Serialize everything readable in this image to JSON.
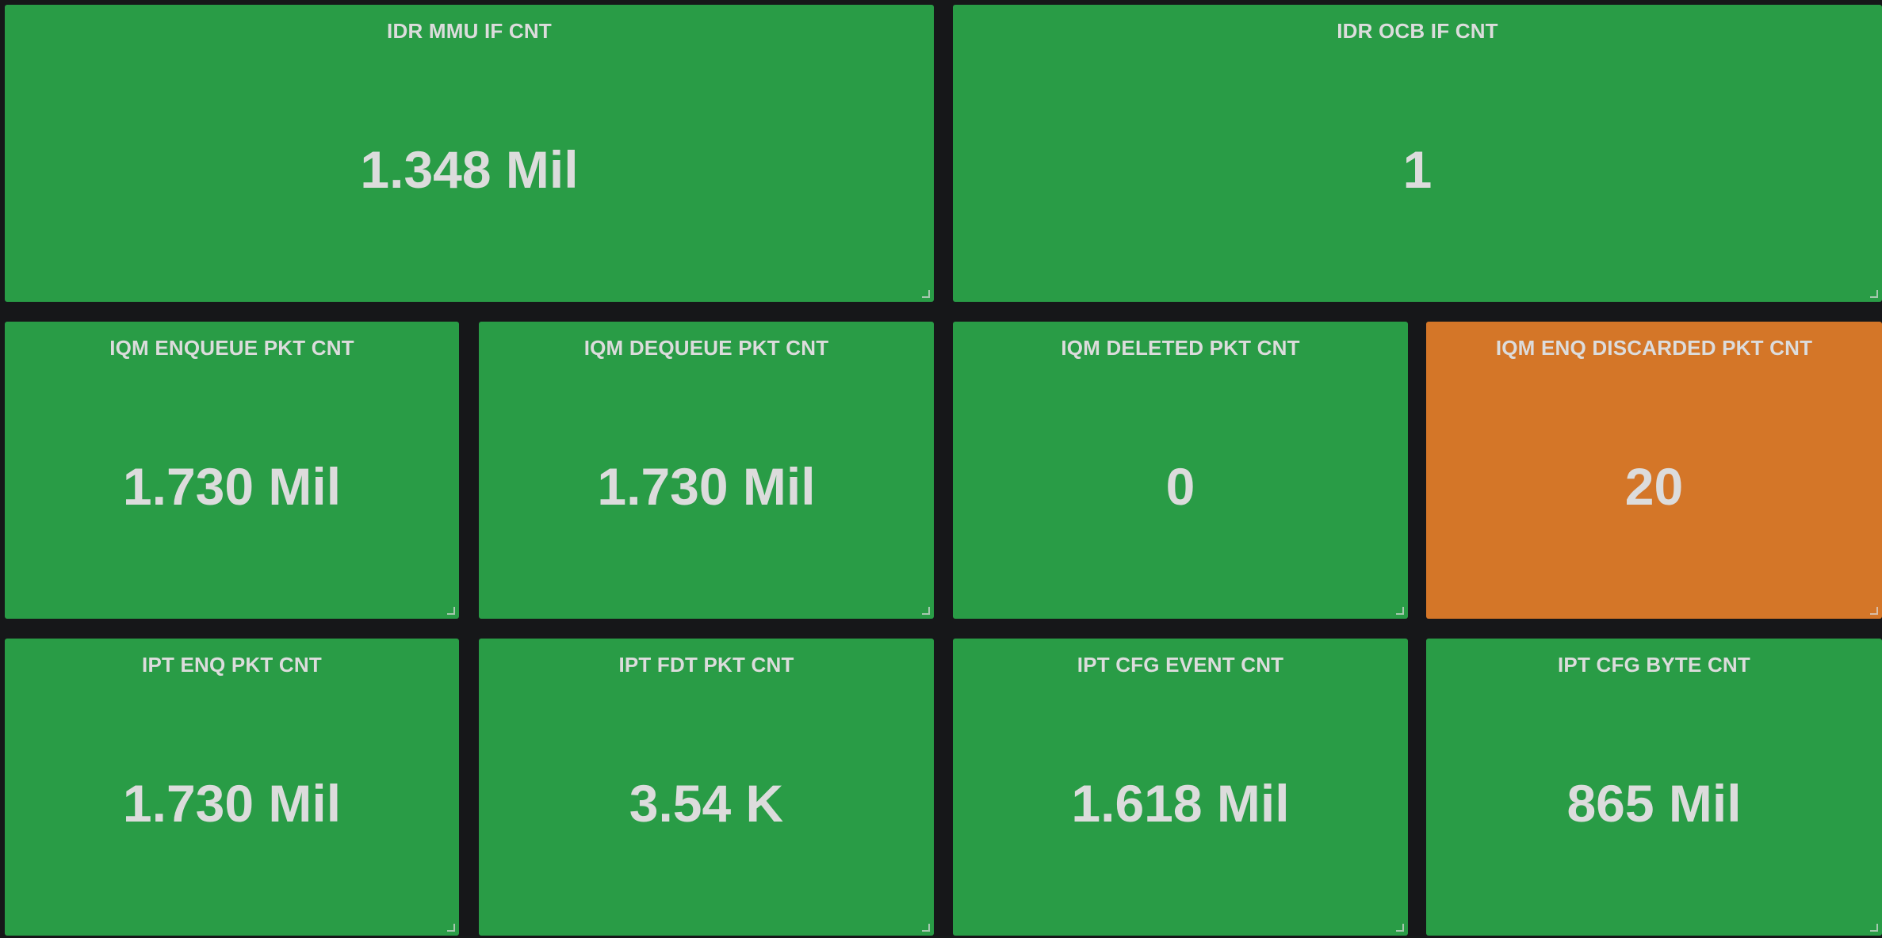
{
  "colors": {
    "background": "#161719",
    "ok": "#299c46",
    "warning": "#d47628",
    "text": "#dcdcdc"
  },
  "panels": [
    {
      "title": "IDR MMU IF CNT",
      "value": "1.348 Mil",
      "status": "ok"
    },
    {
      "title": "IDR OCB IF CNT",
      "value": "1",
      "status": "ok"
    },
    {
      "title": "IQM ENQUEUE PKT CNT",
      "value": "1.730 Mil",
      "status": "ok"
    },
    {
      "title": "IQM DEQUEUE PKT CNT",
      "value": "1.730 Mil",
      "status": "ok"
    },
    {
      "title": "IQM DELETED PKT CNT",
      "value": "0",
      "status": "ok"
    },
    {
      "title": "IQM ENQ DISCARDED PKT CNT",
      "value": "20",
      "status": "warning"
    },
    {
      "title": "IPT ENQ PKT CNT",
      "value": "1.730 Mil",
      "status": "ok"
    },
    {
      "title": "IPT FDT PKT CNT",
      "value": "3.54 K",
      "status": "ok"
    },
    {
      "title": "IPT CFG EVENT CNT",
      "value": "1.618 Mil",
      "status": "ok"
    },
    {
      "title": "IPT CFG BYTE CNT",
      "value": "865 Mil",
      "status": "ok"
    }
  ]
}
